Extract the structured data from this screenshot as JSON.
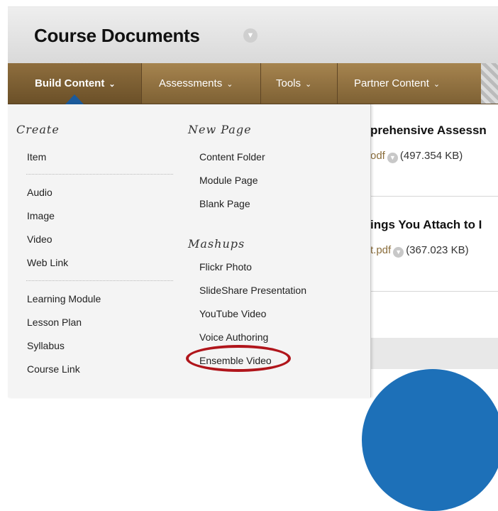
{
  "page": {
    "title": "Course Documents",
    "title_chevron_icon": "chevron-down-icon"
  },
  "toolbar": {
    "items": [
      {
        "label": "Build Content",
        "chevron": "⌄",
        "active": true
      },
      {
        "label": "Assessments",
        "chevron": "⌄"
      },
      {
        "label": "Tools",
        "chevron": "⌄"
      },
      {
        "label": "Partner Content",
        "chevron": "⌄"
      }
    ],
    "colors": {
      "bar": "#8c6d3f",
      "active_pointer": "#1a5a9c"
    }
  },
  "menu": {
    "create": {
      "heading": "Create",
      "groups": [
        [
          "Item"
        ],
        [
          "Audio",
          "Image",
          "Video",
          "Web Link"
        ],
        [
          "Learning Module",
          "Lesson Plan",
          "Syllabus",
          "Course Link"
        ]
      ]
    },
    "new_page": {
      "heading": "New Page",
      "items": [
        "Content Folder",
        "Module Page",
        "Blank Page"
      ]
    },
    "mashups": {
      "heading": "Mashups",
      "items": [
        "Flickr Photo",
        "SlideShare Presentation",
        "YouTube Video",
        "Voice Authoring",
        "Ensemble Video"
      ],
      "highlighted": "Ensemble Video",
      "highlight_color": "#b0151b"
    }
  },
  "content": {
    "items": [
      {
        "title": "prehensive Assessn",
        "file": "odf",
        "size": "(497.354 KB)"
      },
      {
        "title": "ings You Attach to I",
        "file": "t.pdf",
        "size": "(367.023 KB)"
      }
    ]
  }
}
